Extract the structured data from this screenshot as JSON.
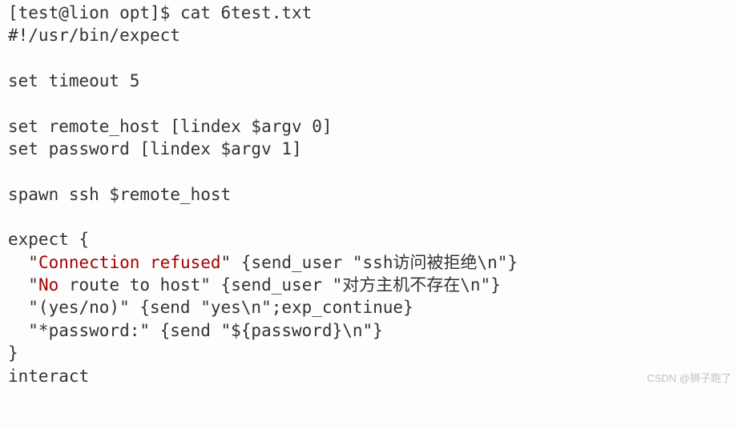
{
  "prompt": "[test@lion opt]$ ",
  "command": "cat 6test.txt",
  "lines": {
    "shebang": "#!/usr/bin/expect",
    "blank": "",
    "timeout": "set timeout 5",
    "remote_host": "set remote_host [lindex $argv 0]",
    "password": "set password [lindex $argv 1]",
    "spawn": "spawn ssh $remote_host",
    "expect_open": "expect {",
    "l1_q1": "\"",
    "l1_red": "Connection refused",
    "l1_rest": "\" {send_user \"ssh访问被拒绝\\n\"}",
    "l2_q1": "\"",
    "l2_red": "No",
    "l2_mid": " route to host",
    "l2_rest": "\" {send_user \"对方主机不存在\\n\"}",
    "l3": "  \"(yes/no)\" {send \"yes\\n\";exp_continue}",
    "l4": "  \"*password:\" {send \"${password}\\n\"}",
    "expect_close": "}",
    "interact": "interact"
  },
  "watermark": "CSDN @狮子跑了"
}
